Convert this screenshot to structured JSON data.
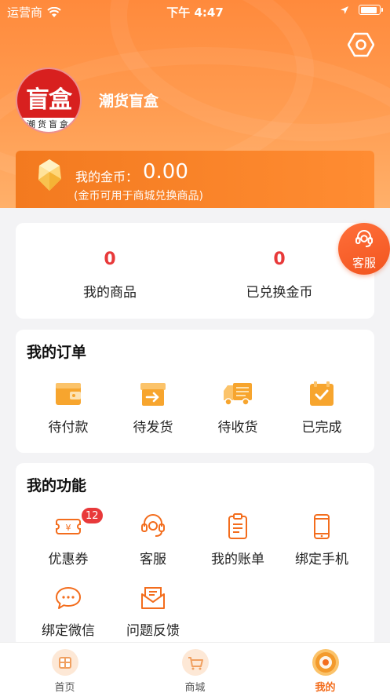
{
  "status_bar": {
    "carrier": "运营商",
    "time": "下午 4:47"
  },
  "profile": {
    "avatar_big_text": "盲盒",
    "avatar_small_text": "潮货盲盒",
    "name": "潮货盲盒"
  },
  "coins": {
    "label": "我的金币：",
    "value": "0.00",
    "note": "(金币可用于商城兑换商品)"
  },
  "stats": [
    {
      "value": "0",
      "label": "我的商品"
    },
    {
      "value": "0",
      "label": "已兑换金币"
    }
  ],
  "customer_service_float": "客服",
  "orders": {
    "title": "我的订单",
    "items": [
      {
        "label": "待付款",
        "icon": "wallet-icon"
      },
      {
        "label": "待发货",
        "icon": "box-arrow-icon"
      },
      {
        "label": "待收货",
        "icon": "truck-icon"
      },
      {
        "label": "已完成",
        "icon": "completed-box-icon"
      }
    ]
  },
  "functions": {
    "title": "我的功能",
    "items": [
      {
        "label": "优惠券",
        "icon": "coupon-icon",
        "badge": "12"
      },
      {
        "label": "客服",
        "icon": "headset-icon"
      },
      {
        "label": "我的账单",
        "icon": "bill-icon"
      },
      {
        "label": "绑定手机",
        "icon": "phone-icon"
      },
      {
        "label": "绑定微信",
        "icon": "chat-bubble-icon"
      },
      {
        "label": "问题反馈",
        "icon": "feedback-icon"
      }
    ]
  },
  "tabbar": [
    {
      "label": "首页",
      "icon": "home-icon"
    },
    {
      "label": "商城",
      "icon": "cart-icon"
    },
    {
      "label": "我的",
      "icon": "profile-icon",
      "active": true
    }
  ],
  "colors": {
    "accent": "#f36d1d",
    "header": "#ff8a3c",
    "number_red": "#e8393a",
    "coin_card": "#f37a1f"
  }
}
